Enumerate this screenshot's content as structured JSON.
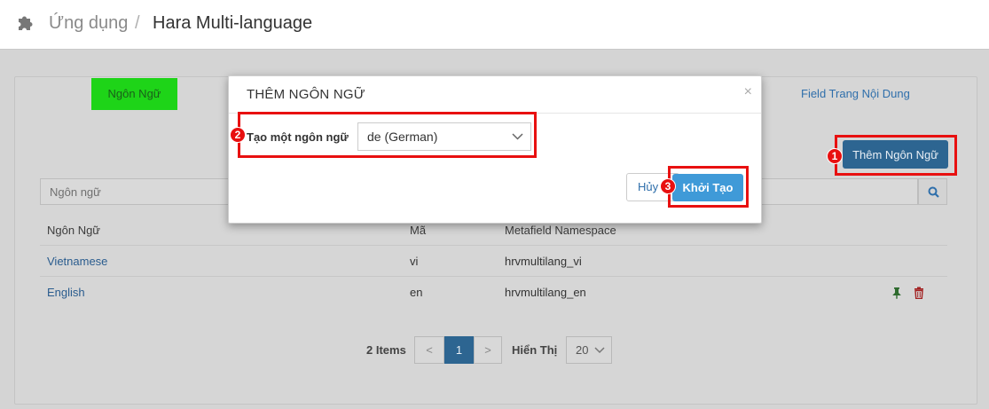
{
  "breadcrumb": {
    "app": "Ứng dụng",
    "separator": "/",
    "current": "Hara Multi-language"
  },
  "tabs": {
    "languages": "Ngôn Ngữ",
    "content_fields": "Field Trang Nội Dung"
  },
  "toolbar": {
    "add_language": "Thêm Ngôn Ngữ"
  },
  "search": {
    "placeholder": "Ngôn ngữ"
  },
  "table": {
    "headers": {
      "language": "Ngôn Ngữ",
      "code": "Mã",
      "namespace": "Metafield Namespace"
    },
    "rows": [
      {
        "language": "Vietnamese",
        "code": "vi",
        "namespace": "hrvmultilang_vi"
      },
      {
        "language": "English",
        "code": "en",
        "namespace": "hrvmultilang_en"
      }
    ]
  },
  "pagination": {
    "items": "2 Items",
    "prev": "<",
    "page": "1",
    "next": ">",
    "show_label": "Hiển Thị",
    "page_size": "20"
  },
  "modal": {
    "title": "THÊM NGÔN NGỮ",
    "close": "×",
    "field_label": "Tạo một ngôn ngữ",
    "selected_language": "de (German)",
    "cancel": "Hủy",
    "create": "Khởi Tạo"
  },
  "annotations": {
    "step1": "1",
    "step2": "2",
    "step3": "3"
  },
  "colors": {
    "primary": "#2d6591",
    "create": "#3f9ad8",
    "highlight": "#e81010",
    "active_tab": "#1ed418",
    "link": "#2f6fab"
  }
}
